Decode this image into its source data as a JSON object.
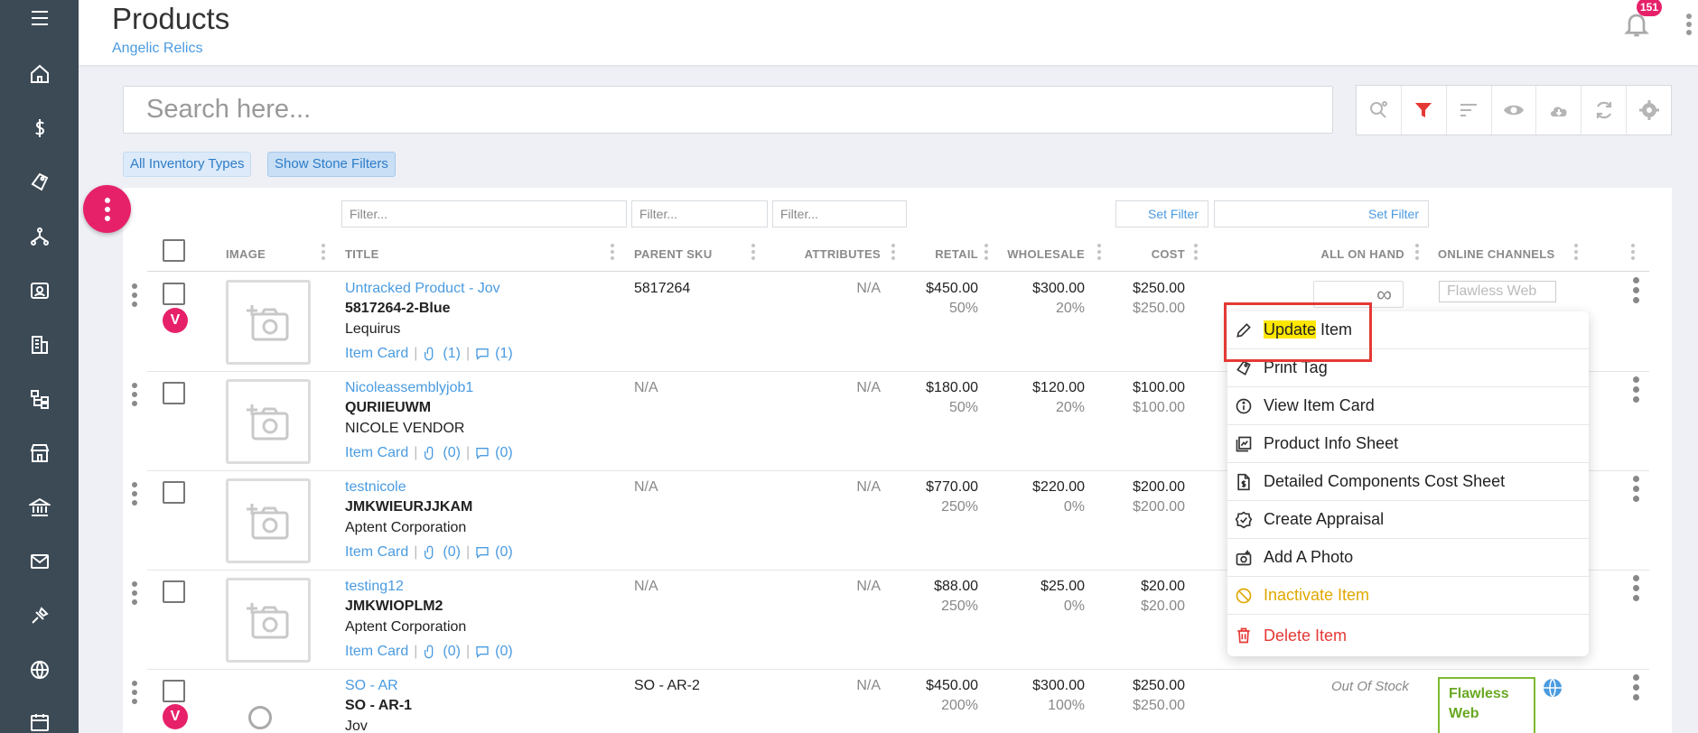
{
  "header": {
    "title": "Products",
    "subtitle": "Angelic Relics",
    "notifications": "151"
  },
  "search": {
    "placeholder": "Search here..."
  },
  "toolbar": {
    "icons": [
      "search-settings-icon",
      "filter-icon",
      "sort-icon",
      "eye-icon",
      "cloud-download-icon",
      "refresh-icon",
      "gear-icon"
    ],
    "accent": "#e53935"
  },
  "chips": {
    "inventory": "All Inventory Types",
    "stone": "Show Stone Filters"
  },
  "filters": {
    "title": "Filter...",
    "parent_sku": "Filter...",
    "attributes": "Filter...",
    "set_filter_1": "Set Filter",
    "set_filter_2": "Set Filter"
  },
  "columns": [
    "IMAGE",
    "TITLE",
    "PARENT SKU",
    "ATTRIBUTES",
    "RETAIL",
    "WHOLESALE",
    "COST",
    "ALL ON HAND",
    "ONLINE CHANNELS"
  ],
  "rows": [
    {
      "title": "Untracked Product - Jov",
      "sku": "5817264-2-Blue",
      "vendor": "Lequirus",
      "parent_sku": "5817264",
      "attributes": "N/A",
      "retail": "$450.00",
      "retail_pct": "50%",
      "wholesale": "$300.00",
      "wholesale_pct": "20%",
      "cost": "$250.00",
      "cost2": "$250.00",
      "item_card": "Item Card",
      "attachments": "(1)",
      "comments": "(1)",
      "channel": "Flawless Web",
      "badge": "V"
    },
    {
      "title": "Nicoleassemblyjob1",
      "sku": "QURIIEUWM",
      "vendor": "NICOLE VENDOR",
      "parent_sku": "N/A",
      "attributes": "N/A",
      "retail": "$180.00",
      "retail_pct": "50%",
      "wholesale": "$120.00",
      "wholesale_pct": "20%",
      "cost": "$100.00",
      "cost2": "$100.00",
      "item_card": "Item Card",
      "attachments": "(0)",
      "comments": "(0)"
    },
    {
      "title": "testnicole",
      "sku": "JMKWIEURJJKAM",
      "vendor": "Aptent Corporation",
      "parent_sku": "N/A",
      "attributes": "N/A",
      "retail": "$770.00",
      "retail_pct": "250%",
      "wholesale": "$220.00",
      "wholesale_pct": "0%",
      "cost": "$200.00",
      "cost2": "$200.00",
      "item_card": "Item Card",
      "attachments": "(0)",
      "comments": "(0)"
    },
    {
      "title": "testing12",
      "sku": "JMKWIOPLM2",
      "vendor": "Aptent Corporation",
      "parent_sku": "N/A",
      "attributes": "N/A",
      "retail": "$88.00",
      "retail_pct": "250%",
      "wholesale": "$25.00",
      "wholesale_pct": "0%",
      "cost": "$20.00",
      "cost2": "$20.00",
      "item_card": "Item Card",
      "attachments": "(0)",
      "comments": "(0)"
    },
    {
      "title": "SO - AR",
      "sku": "SO - AR-1",
      "vendor": "Jov",
      "parent_sku": "SO - AR-2",
      "attributes": "N/A",
      "retail": "$450.00",
      "retail_pct": "200%",
      "wholesale": "$300.00",
      "wholesale_pct": "100%",
      "cost": "$250.00",
      "cost2": "$250.00",
      "on_hand": "Out Of Stock",
      "channel_line1": "Flawless",
      "channel_line2": "Web",
      "badge": "V"
    }
  ],
  "on_hand_symbol": "∞",
  "context_menu": {
    "items": [
      {
        "label_highlight": "Update",
        "label_rest": " Item",
        "icon": "pencil-icon"
      },
      {
        "label": "Print Tag",
        "icon": "tag-icon"
      },
      {
        "label": "View Item Card",
        "icon": "info-icon"
      },
      {
        "label": "Product Info Sheet",
        "icon": "sheet-icon"
      },
      {
        "label": "Detailed Components Cost Sheet",
        "icon": "cost-sheet-icon"
      },
      {
        "label": "Create Appraisal",
        "icon": "badge-check-icon"
      },
      {
        "label": "Add A Photo",
        "icon": "add-photo-icon"
      },
      {
        "label": "Inactivate Item",
        "icon": "ban-icon",
        "color": "#e0a800"
      },
      {
        "label": "Delete Item",
        "icon": "trash-icon",
        "color": "#e53935"
      }
    ]
  }
}
